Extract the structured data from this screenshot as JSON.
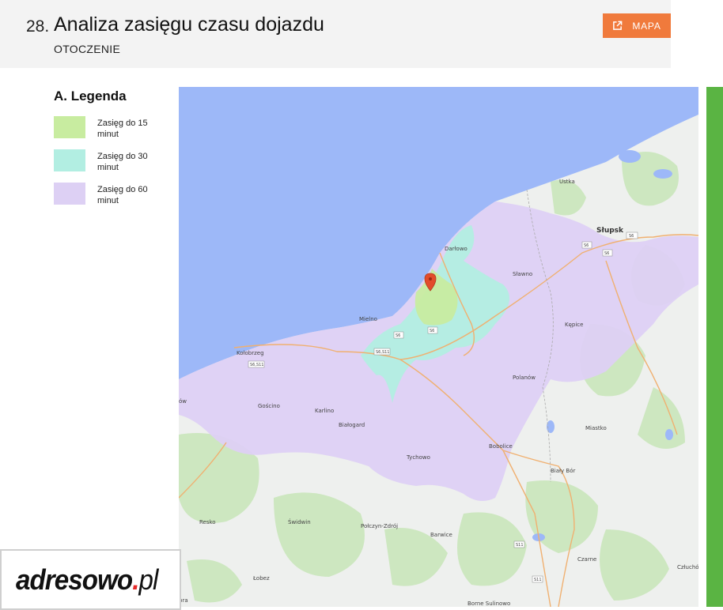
{
  "header": {
    "section_number": "28.",
    "title": "Analiza zasięgu czasu dojazdu",
    "subtitle": "OTOCZENIE",
    "map_button_label": "MAPA"
  },
  "legend": {
    "title": "A. Legenda",
    "items": [
      {
        "label": "Zasięg do 15 minut",
        "color": "#c8eca0"
      },
      {
        "label": "Zasięg do 30 minut",
        "color": "#b2eee2"
      },
      {
        "label": "Zasięg do 60 minut",
        "color": "#ddd0f4"
      }
    ]
  },
  "map": {
    "sea_color": "#9db8f8",
    "land_color": "#eef0ee",
    "forest_color": "#cde7c0",
    "marker_color": "#e24c2b",
    "towns": {
      "slupsk": "Słupsk",
      "ustka": "Ustka",
      "darlowo": "Darłowo",
      "slawno": "Sławno",
      "kepice": "Kępice",
      "mielno": "Mielno",
      "kolobrzeg": "Kołobrzeg",
      "goscino": "Gościno",
      "karlino": "Karlino",
      "bialogard": "Białogard",
      "polanow": "Polanów",
      "miastko": "Miastko",
      "tychowo": "Tychowo",
      "bobolice": "Bobolice",
      "bialy_bor": "Biały Bór",
      "resko": "Resko",
      "swidwin": "Świdwin",
      "polczyn": "Połczyn-Zdrój",
      "barwice": "Barwice",
      "czarne": "Czarne",
      "lobez": "Łobez",
      "borne": "Borne Sulinowo",
      "czluchow": "Człuchó",
      "edge_left": "ów",
      "edge_bottom_left": "bra"
    },
    "roads": {
      "s6_a": "S6",
      "s6_b": "S6",
      "s6_c": "S6",
      "s6_d": "S6",
      "s6_e": "S6",
      "s6s11_a": "S6,S11",
      "s6s11_b": "S6,S11",
      "s11_a": "S11",
      "s11_b": "S11"
    }
  },
  "logo": {
    "name": "adresowo",
    "dot": ".",
    "tld": "pl"
  }
}
